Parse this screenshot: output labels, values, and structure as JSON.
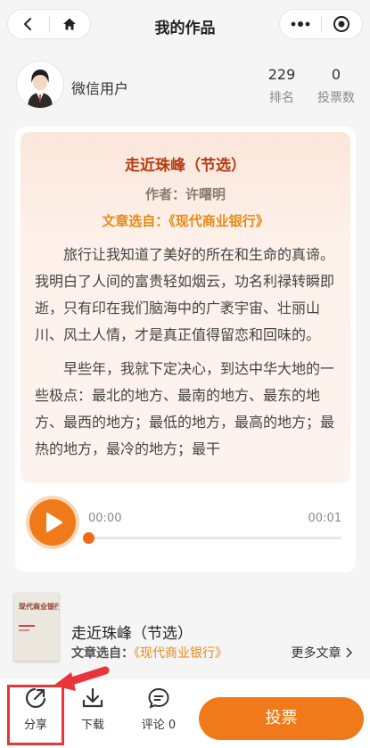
{
  "nav": {
    "title": "我的作品"
  },
  "user": {
    "name": "微信用户",
    "rank_value": "229",
    "rank_label": "排名",
    "votes_value": "0",
    "votes_label": "投票数"
  },
  "article": {
    "title": "走近珠峰（节选）",
    "author": "作者：许曙明",
    "source_prefix": "文章选自：",
    "source_book": "《现代商业银行》",
    "paragraphs": [
      "旅行让我知道了美好的所在和生命的真谛。我明白了人间的富贵轻如烟云，功名利禄转瞬即逝，只有印在我们脑海中的广袤宇宙、壮丽山川、风土人情，才是真正值得留恋和回味的。",
      "早些年，我就下定决心，到达中华大地的一些极点：最北的地方、最南的地方、最东的地方、最西的地方；最低的地方，最高的地方；最热的地方，最冷的地方；最干"
    ]
  },
  "player": {
    "current_time": "00:00",
    "duration": "00:01",
    "progress": 0
  },
  "book": {
    "cover_title": "现代商业银行",
    "title": "走近珠峰（节选）",
    "source_prefix": "文章选自：",
    "source_book": "《现代商业银行》",
    "more_label": "更多文章"
  },
  "bottom": {
    "share_label": "分享",
    "download_label": "下载",
    "comment_label": "评论 0",
    "vote_label": "投票"
  },
  "colors": {
    "accent": "#f07a1a",
    "title_red": "#b53b12",
    "source_orange": "#e58a16",
    "annotation_red": "#e8353a"
  }
}
